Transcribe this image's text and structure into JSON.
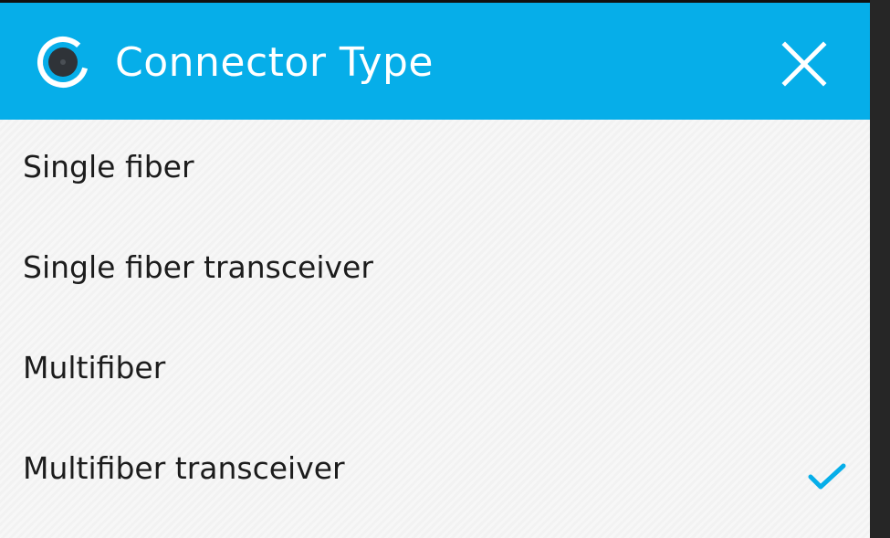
{
  "dialog": {
    "title": "Connector Type",
    "accent_color": "#06aee9",
    "logo_icon": "c-ring-logo-icon",
    "close_icon": "close-icon"
  },
  "options": [
    {
      "label": "Single fiber",
      "selected": false
    },
    {
      "label": "Single fiber transceiver",
      "selected": false
    },
    {
      "label": "Multifiber",
      "selected": false
    },
    {
      "label": "Multifiber transceiver",
      "selected": true
    }
  ],
  "selection_icon": "check-icon"
}
